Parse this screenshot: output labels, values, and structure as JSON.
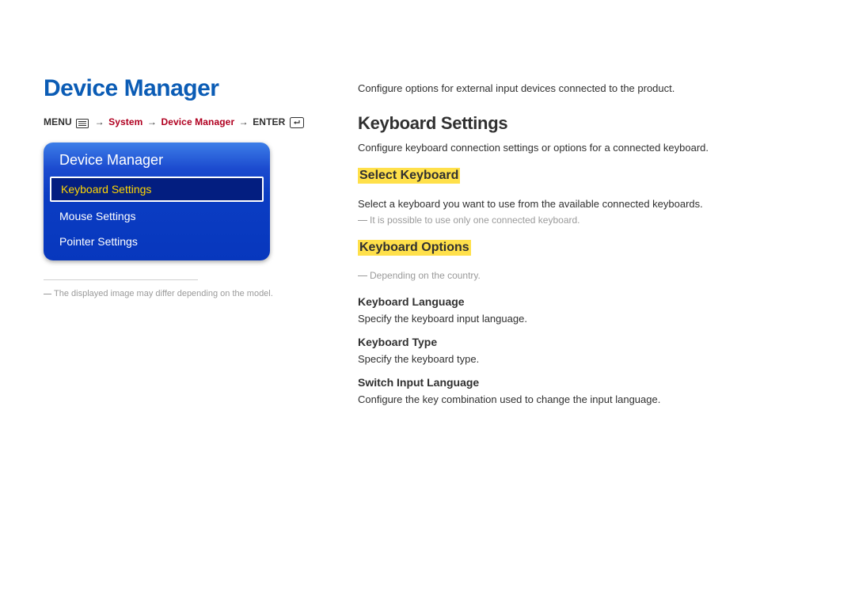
{
  "left": {
    "title": "Device Manager",
    "breadcrumb": {
      "menu": "MENU",
      "arrow": "→",
      "system": "System",
      "dm": "Device Manager",
      "enter": "ENTER"
    },
    "panel": {
      "header": "Device Manager",
      "items": [
        {
          "label": "Keyboard Settings",
          "selected": true
        },
        {
          "label": "Mouse Settings",
          "selected": false
        },
        {
          "label": "Pointer Settings",
          "selected": false
        }
      ]
    },
    "disclaimer": "The displayed image may differ depending on the model."
  },
  "right": {
    "intro": "Configure options for external input devices connected to the product.",
    "keyboard_settings": {
      "heading": "Keyboard Settings",
      "desc": "Configure keyboard connection settings or options for a connected keyboard."
    },
    "select_keyboard": {
      "heading": "Select Keyboard",
      "desc": "Select a keyboard you want to use from the available connected keyboards.",
      "note": "It is possible to use only one connected keyboard."
    },
    "keyboard_options": {
      "heading": "Keyboard Options",
      "note": "Depending on the country.",
      "subs": [
        {
          "h": "Keyboard Language",
          "p": "Specify the keyboard input language."
        },
        {
          "h": "Keyboard Type",
          "p": "Specify the keyboard type."
        },
        {
          "h": "Switch Input Language",
          "p": "Configure the key combination used to change the input language."
        }
      ]
    }
  }
}
